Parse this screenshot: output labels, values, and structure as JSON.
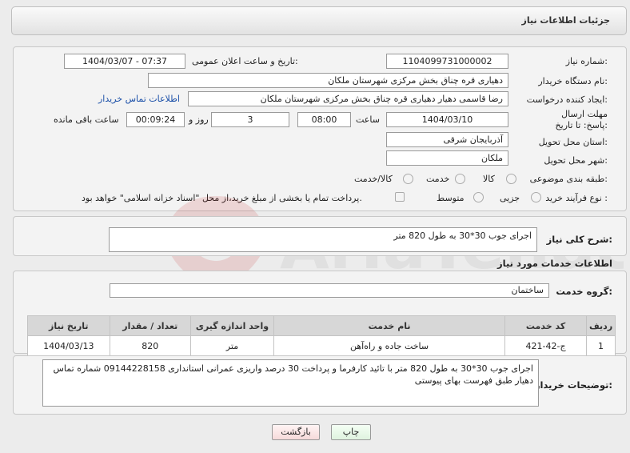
{
  "header": {
    "title": "جزئیات اطلاعات نیاز"
  },
  "labels": {
    "need_number": "شماره نیاز:",
    "announce_datetime": "تاریخ و ساعت اعلان عمومی:",
    "buyer_org": "نام دستگاه خریدار:",
    "requester": "ایجاد کننده درخواست:",
    "buyer_contact_link": "اطلاعات تماس خریدار",
    "deadline": "مهلت ارسال پاسخ: تا تاریخ:",
    "hour_word": "ساعت",
    "day_word": "روز و",
    "remaining_word": "ساعت باقی مانده",
    "province": "استان محل تحویل:",
    "city": "شهر محل تحویل:",
    "category": "طبقه بندی موضوعی:",
    "process_type": "نوع فرآیند خرید :",
    "description_title": "شرح کلی نیاز:",
    "services_title": "اطلاعات خدمات مورد نیاز",
    "service_group": "گروه خدمت:",
    "buyer_notes": "توضیحات خریدار:"
  },
  "values": {
    "need_number": "1104099731000002",
    "announce_datetime": "1404/03/07 - 07:37",
    "buyer_org": "دهیاری قره چناق بخش مرکزی شهرستان ملکان",
    "requester": "رضا قاسمی دهیار دهیاری قره چناق بخش مرکزی شهرستان ملکان",
    "deadline_date": "1404/03/10",
    "deadline_time": "08:00",
    "days_left": "3",
    "time_left": "00:09:24",
    "province": "آذربایجان شرقی",
    "city": "ملکان",
    "description": "اجرای جوب 30*30 به طول 820 متر",
    "service_group": "ساختمان",
    "buyer_notes": "اجرای جوب 30*30 به طول 820 متر با تائید کارفرما و پرداخت 30 درصد واریزی عمرانی استانداری 09144228158 شماره تماس دهیار طبق فهرست بهای پیوستی"
  },
  "category_options": [
    "کالا",
    "خدمت",
    "کالا/خدمت"
  ],
  "process_options": [
    "جزیی",
    "متوسط"
  ],
  "payment_note": "پرداخت تمام یا بخشی از مبلغ خرید،از محل \"اسناد خزانه اسلامی\" خواهد بود.",
  "table": {
    "headers": [
      "ردیف",
      "کد خدمت",
      "نام خدمت",
      "واحد اندازه گیری",
      "تعداد / مقدار",
      "تاریخ نیاز"
    ],
    "rows": [
      [
        "1",
        "ج-42-421",
        "ساخت جاده و راه‌آهن",
        "متر",
        "820",
        "1404/03/13"
      ]
    ]
  },
  "buttons": {
    "print": "چاپ",
    "back": "بازگشت"
  },
  "watermark": {
    "text": "AriaTender.net"
  }
}
